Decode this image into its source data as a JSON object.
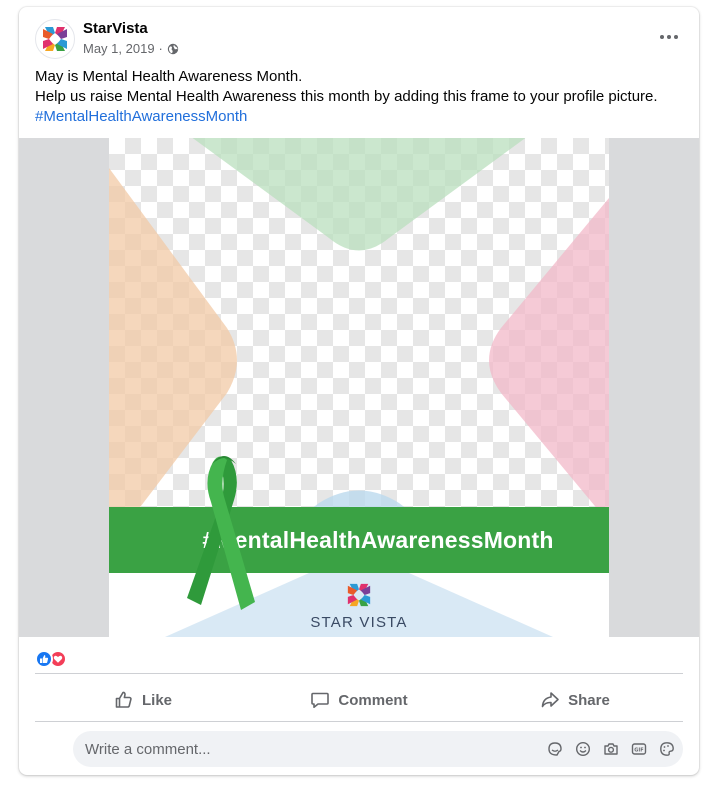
{
  "post": {
    "page_name": "StarVista",
    "date": "May 1, 2019",
    "separator": "·",
    "audience_icon": "globe-icon",
    "text_line1": "May is Mental Health Awareness Month.",
    "text_line2": "Help us raise Mental Health Awareness this month by adding this frame to your profile picture.",
    "hashtag": "#MentalHealthAwarenessMonth"
  },
  "image": {
    "banner_text": "#MentalHealthAwarenessMonth",
    "brand_name": "STAR VISTA",
    "ribbon_color": "#3aa244"
  },
  "reactions": {
    "icons": [
      "like-icon",
      "love-icon"
    ]
  },
  "actions": {
    "like": "Like",
    "comment": "Comment",
    "share": "Share"
  },
  "comment_box": {
    "placeholder": "Write a comment...",
    "icons": [
      "sticker-icon",
      "emoji-icon",
      "camera-icon",
      "gif-icon",
      "avatar-sticker-icon"
    ]
  },
  "colors": {
    "link": "#216fdb",
    "like_blue": "#1877f2",
    "love_red": "#f33e58",
    "banner_green": "#3aa244"
  }
}
